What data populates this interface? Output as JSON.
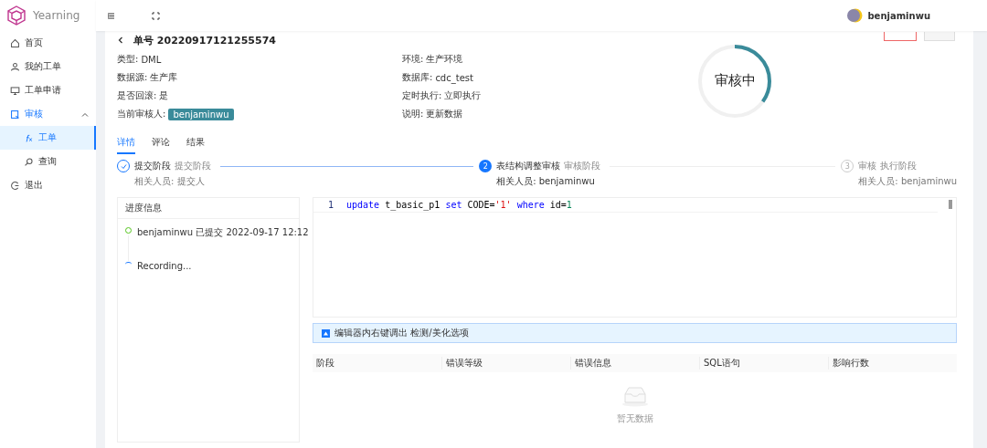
{
  "app": {
    "name": "Yearning"
  },
  "header": {
    "user": "benjaminwu"
  },
  "sidebar": {
    "items": [
      {
        "label": "首页",
        "selected": false
      },
      {
        "label": "我的工单",
        "selected": false
      },
      {
        "label": "工单申请",
        "selected": false
      },
      {
        "label": "审核",
        "selected": false,
        "expanded": true,
        "children": [
          {
            "label": "工单",
            "selected": true
          },
          {
            "label": "查询",
            "selected": false
          }
        ]
      },
      {
        "label": "退出",
        "selected": false
      }
    ]
  },
  "order": {
    "title": "单号 20220917121255574",
    "fields_left": [
      {
        "label": "类型:",
        "value": "DML"
      },
      {
        "label": "数据源:",
        "value": "生产库"
      },
      {
        "label": "是否回滚:",
        "value": "是"
      },
      {
        "label": "当前审核人:",
        "value": "benjaminwu",
        "kind": "tag"
      }
    ],
    "fields_right": [
      {
        "label": "环境:",
        "value": "生产环境"
      },
      {
        "label": "数据库:",
        "value": "cdc_test"
      },
      {
        "label": "定时执行:",
        "value": "立即执行"
      },
      {
        "label": "说明:",
        "value": "更新数据"
      }
    ],
    "status": {
      "label": "审核中",
      "level": 0.35
    }
  },
  "tabs": [
    {
      "label": "详情",
      "selected": true
    },
    {
      "label": "评论",
      "selected": false
    },
    {
      "label": "结果",
      "selected": false
    }
  ],
  "steps": [
    {
      "kind": "done",
      "title": "提交阶段",
      "subtitle": "提交阶段",
      "people": "相关人员: 提交人"
    },
    {
      "kind": "current",
      "number": "2",
      "title": "表结构调整审核",
      "subtitle": "审核阶段",
      "people": "相关人员: benjaminwu"
    },
    {
      "kind": "waiting",
      "number": "3",
      "title": "审核",
      "subtitle": "执行阶段",
      "people": "相关人员: benjaminwu"
    }
  ],
  "progress": {
    "title": "进度信息",
    "items": [
      {
        "text": "benjaminwu 已提交 2022-09-17 12:12",
        "kind": "done"
      },
      {
        "text": "Recording...",
        "kind": "pending"
      }
    ]
  },
  "editor": {
    "lines": [
      {
        "number": "1",
        "tokens": [
          {
            "text": "update",
            "kind": "keyword"
          },
          {
            "text": " t_basic_p1 ",
            "kind": "plain"
          },
          {
            "text": "set",
            "kind": "keyword"
          },
          {
            "text": " CODE=",
            "kind": "plain"
          },
          {
            "text": "'1'",
            "kind": "string"
          },
          {
            "text": " where",
            "kind": "keyword"
          },
          {
            "text": " id=",
            "kind": "plain"
          },
          {
            "text": "1",
            "kind": "number"
          }
        ]
      }
    ]
  },
  "alert": {
    "text": "编辑器内右键调出 检测/美化选项"
  },
  "table": {
    "columns": [
      "阶段",
      "错误等级",
      "错误信息",
      "SQL语句",
      "影响行数"
    ],
    "empty_text": "暂无数据"
  }
}
